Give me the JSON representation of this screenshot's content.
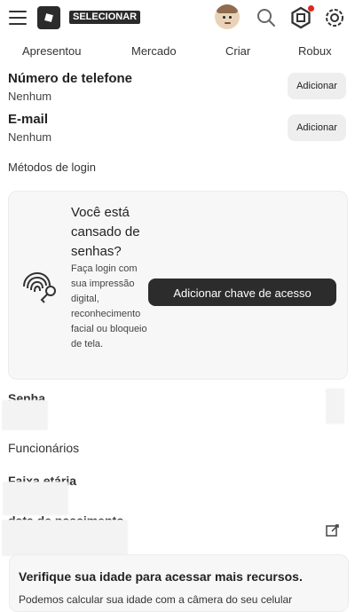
{
  "header": {
    "select_label": "SELECIONAR",
    "icons": [
      "menu-icon",
      "roblox-logo",
      "avatar",
      "search-icon",
      "robux-icon",
      "settings-icon"
    ],
    "notification_color": "#e1251b"
  },
  "tabs": [
    {
      "label": "Apresentou"
    },
    {
      "label": "Mercado"
    },
    {
      "label": "Criar"
    },
    {
      "label": "Robux"
    }
  ],
  "account": {
    "phone": {
      "title": "Número de telefone",
      "value": "Nenhum",
      "button": "Adicionar"
    },
    "email": {
      "title": "E-mail",
      "value": "Nenhum",
      "button": "Adicionar"
    },
    "login_methods": "Métodos de login"
  },
  "passkey_card": {
    "title": "Você está cansado de senhas?",
    "description": "Faça login com sua impressão digital, reconhecimento facial ou bloqueio de tela.",
    "button": "Adicionar chave de acesso"
  },
  "sections": {
    "password": "Senha",
    "employees": "Funcionários",
    "age_range": "Faixa etária",
    "birth_date": "data de nascimento"
  },
  "verify_card": {
    "title": "Verifique sua idade para acessar mais recursos.",
    "text": "Podemos calcular sua idade com a câmera do seu celular"
  }
}
